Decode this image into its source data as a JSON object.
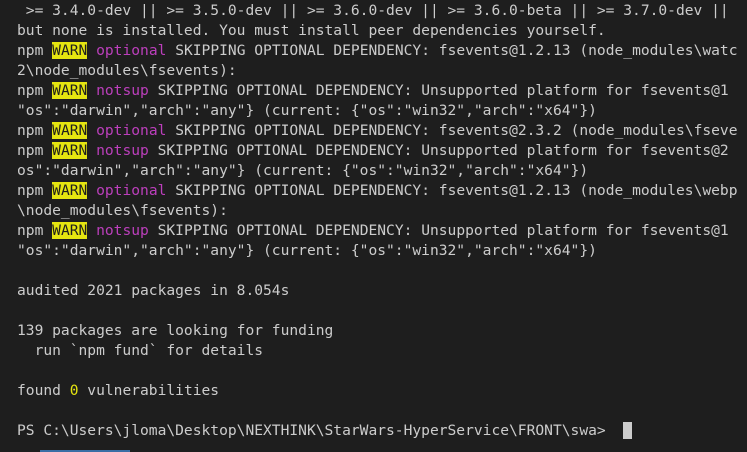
{
  "terminal": {
    "lines": [
      {
        "parts": [
          {
            "text": " >= 3.4.0-dev || >= 3.5.0-dev || >= 3.6.0-dev || >= 3.6.0-beta || >= 3.7.0-dev || ",
            "style": ""
          }
        ]
      },
      {
        "parts": [
          {
            "text": "but none is installed. You must install peer dependencies yourself.",
            "style": ""
          }
        ]
      },
      {
        "parts": [
          {
            "text": "npm ",
            "style": ""
          },
          {
            "text": "WARN",
            "style": "warn"
          },
          {
            "text": " ",
            "style": ""
          },
          {
            "text": "optional",
            "style": "magenta"
          },
          {
            "text": " SKIPPING OPTIONAL DEPENDENCY: fsevents@1.2.13 (node_modules\\watc",
            "style": ""
          }
        ]
      },
      {
        "parts": [
          {
            "text": "2\\node_modules\\fsevents):",
            "style": ""
          }
        ]
      },
      {
        "parts": [
          {
            "text": "npm ",
            "style": ""
          },
          {
            "text": "WARN",
            "style": "warn"
          },
          {
            "text": " ",
            "style": ""
          },
          {
            "text": "notsup",
            "style": "magenta"
          },
          {
            "text": " SKIPPING OPTIONAL DEPENDENCY: Unsupported platform for fsevents@1",
            "style": ""
          }
        ]
      },
      {
        "parts": [
          {
            "text": "\"os\":\"darwin\",\"arch\":\"any\"} (current: {\"os\":\"win32\",\"arch\":\"x64\"})",
            "style": ""
          }
        ]
      },
      {
        "parts": [
          {
            "text": "npm ",
            "style": ""
          },
          {
            "text": "WARN",
            "style": "warn"
          },
          {
            "text": " ",
            "style": ""
          },
          {
            "text": "optional",
            "style": "magenta"
          },
          {
            "text": " SKIPPING OPTIONAL DEPENDENCY: fsevents@2.3.2 (node_modules\\fseve",
            "style": ""
          }
        ]
      },
      {
        "parts": [
          {
            "text": "npm ",
            "style": ""
          },
          {
            "text": "WARN",
            "style": "warn"
          },
          {
            "text": " ",
            "style": ""
          },
          {
            "text": "notsup",
            "style": "magenta"
          },
          {
            "text": " SKIPPING OPTIONAL DEPENDENCY: Unsupported platform for fsevents@2",
            "style": ""
          }
        ]
      },
      {
        "parts": [
          {
            "text": "os\":\"darwin\",\"arch\":\"any\"} (current: {\"os\":\"win32\",\"arch\":\"x64\"})",
            "style": ""
          }
        ]
      },
      {
        "parts": [
          {
            "text": "npm ",
            "style": ""
          },
          {
            "text": "WARN",
            "style": "warn"
          },
          {
            "text": " ",
            "style": ""
          },
          {
            "text": "optional",
            "style": "magenta"
          },
          {
            "text": " SKIPPING OPTIONAL DEPENDENCY: fsevents@1.2.13 (node_modules\\webp",
            "style": ""
          }
        ]
      },
      {
        "parts": [
          {
            "text": "\\node_modules\\fsevents):",
            "style": ""
          }
        ]
      },
      {
        "parts": [
          {
            "text": "npm ",
            "style": ""
          },
          {
            "text": "WARN",
            "style": "warn"
          },
          {
            "text": " ",
            "style": ""
          },
          {
            "text": "notsup",
            "style": "magenta"
          },
          {
            "text": " SKIPPING OPTIONAL DEPENDENCY: Unsupported platform for fsevents@1",
            "style": ""
          }
        ]
      },
      {
        "parts": [
          {
            "text": "\"os\":\"darwin\",\"arch\":\"any\"} (current: {\"os\":\"win32\",\"arch\":\"x64\"})",
            "style": ""
          }
        ]
      },
      {
        "parts": []
      },
      {
        "parts": [
          {
            "text": "audited 2021 packages in 8.054s",
            "style": ""
          }
        ]
      },
      {
        "parts": []
      },
      {
        "parts": [
          {
            "text": "139 packages are looking for funding",
            "style": ""
          }
        ]
      },
      {
        "parts": [
          {
            "text": "  run `npm fund` for details",
            "style": ""
          }
        ]
      },
      {
        "parts": []
      },
      {
        "parts": [
          {
            "text": "found ",
            "style": ""
          },
          {
            "text": "0",
            "style": "yellow"
          },
          {
            "text": " vulnerabilities",
            "style": ""
          }
        ]
      },
      {
        "parts": []
      },
      {
        "parts": [
          {
            "text": "PS C:\\Users\\jloma\\Desktop\\NEXTHINK\\StarWars-HyperService\\FRONT\\swa> ",
            "style": ""
          }
        ],
        "cursor": true
      }
    ]
  },
  "colors": {
    "background": "#1e1e1e",
    "text": "#cccccc",
    "warn_bg": "#e5e510",
    "magenta": "#bc3fbc",
    "yellow": "#e5e510"
  }
}
